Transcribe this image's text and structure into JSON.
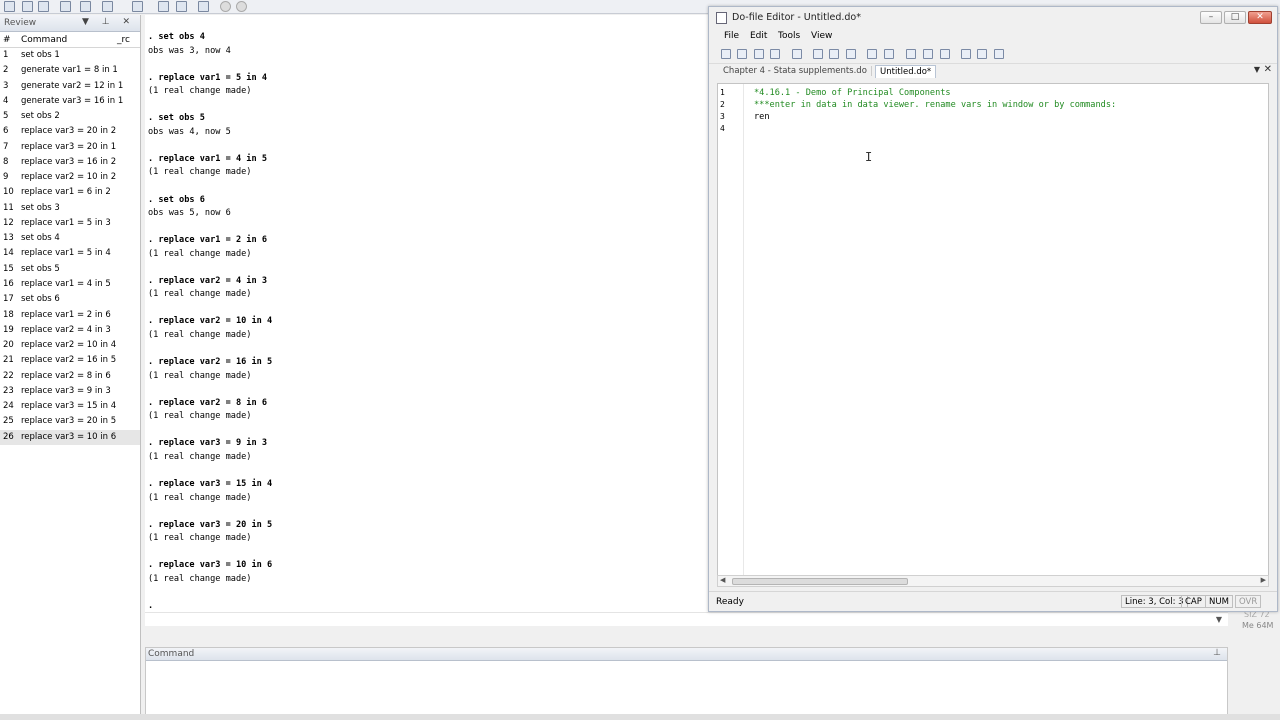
{
  "review": {
    "title": "Review",
    "col_num": "#",
    "col_cmd": "Command",
    "col_rc": "_rc",
    "items": [
      {
        "n": "1",
        "cmd": "set obs 1"
      },
      {
        "n": "2",
        "cmd": "generate var1 = 8 in 1"
      },
      {
        "n": "3",
        "cmd": "generate var2 = 12 in 1"
      },
      {
        "n": "4",
        "cmd": "generate var3 = 16 in 1"
      },
      {
        "n": "5",
        "cmd": "set obs 2"
      },
      {
        "n": "6",
        "cmd": "replace var3 = 20 in 2"
      },
      {
        "n": "7",
        "cmd": "replace var3 = 20 in 1"
      },
      {
        "n": "8",
        "cmd": "replace var3 = 16 in 2"
      },
      {
        "n": "9",
        "cmd": "replace var2 = 10 in 2"
      },
      {
        "n": "10",
        "cmd": "replace var1 = 6 in 2"
      },
      {
        "n": "11",
        "cmd": "set obs 3"
      },
      {
        "n": "12",
        "cmd": "replace var1 = 5 in 3"
      },
      {
        "n": "13",
        "cmd": "set obs 4"
      },
      {
        "n": "14",
        "cmd": "replace var1 = 5 in 4"
      },
      {
        "n": "15",
        "cmd": "set obs 5"
      },
      {
        "n": "16",
        "cmd": "replace var1 = 4 in 5"
      },
      {
        "n": "17",
        "cmd": "set obs 6"
      },
      {
        "n": "18",
        "cmd": "replace var1 = 2 in 6"
      },
      {
        "n": "19",
        "cmd": "replace var2 = 4 in 3"
      },
      {
        "n": "20",
        "cmd": "replace var2 = 10 in 4"
      },
      {
        "n": "21",
        "cmd": "replace var2 = 16 in 5"
      },
      {
        "n": "22",
        "cmd": "replace var2 = 8 in 6"
      },
      {
        "n": "23",
        "cmd": "replace var3 = 9 in 3"
      },
      {
        "n": "24",
        "cmd": "replace var3 = 15 in 4"
      },
      {
        "n": "25",
        "cmd": "replace var3 = 20 in 5"
      },
      {
        "n": "26",
        "cmd": "replace var3 = 10 in 6"
      }
    ]
  },
  "results": {
    "lines": [
      ". set obs 4",
      "obs was 3, now 4",
      "",
      ". replace var1 = 5 in 4",
      "(1 real change made)",
      "",
      ". set obs 5",
      "obs was 4, now 5",
      "",
      ". replace var1 = 4 in 5",
      "(1 real change made)",
      "",
      ". set obs 6",
      "obs was 5, now 6",
      "",
      ". replace var1 = 2 in 6",
      "(1 real change made)",
      "",
      ". replace var2 = 4 in 3",
      "(1 real change made)",
      "",
      ". replace var2 = 10 in 4",
      "(1 real change made)",
      "",
      ". replace var2 = 16 in 5",
      "(1 real change made)",
      "",
      ". replace var2 = 8 in 6",
      "(1 real change made)",
      "",
      ". replace var3 = 9 in 3",
      "(1 real change made)",
      "",
      ". replace var3 = 15 in 4",
      "(1 real change made)",
      "",
      ". replace var3 = 20 in 5",
      "(1 real change made)",
      "",
      ". replace var3 = 10 in 6",
      "(1 real change made)",
      "",
      "."
    ]
  },
  "command": {
    "title": "Command"
  },
  "vars_edge": {
    "l1": "SIZ 72",
    "l2": "Me 64M"
  },
  "editor": {
    "title": "Do-file Editor - Untitled.do*",
    "menu": [
      "File",
      "Edit",
      "Tools",
      "View"
    ],
    "tabs": [
      "Chapter 4 - Stata supplements.do",
      "Untitled.do*"
    ],
    "code": [
      {
        "n": "1",
        "text": "*4.16.1 - Demo of Principal Components",
        "comment": true
      },
      {
        "n": "2",
        "text": "***enter in data in data viewer. rename vars in window or by commands:",
        "comment": true
      },
      {
        "n": "3",
        "text": "ren",
        "comment": false
      },
      {
        "n": "4",
        "text": "",
        "comment": false
      }
    ],
    "status": {
      "ready": "Ready",
      "position": "Line: 3, Col: 3",
      "cap": "CAP",
      "num": "NUM",
      "ovr": "OVR"
    }
  }
}
